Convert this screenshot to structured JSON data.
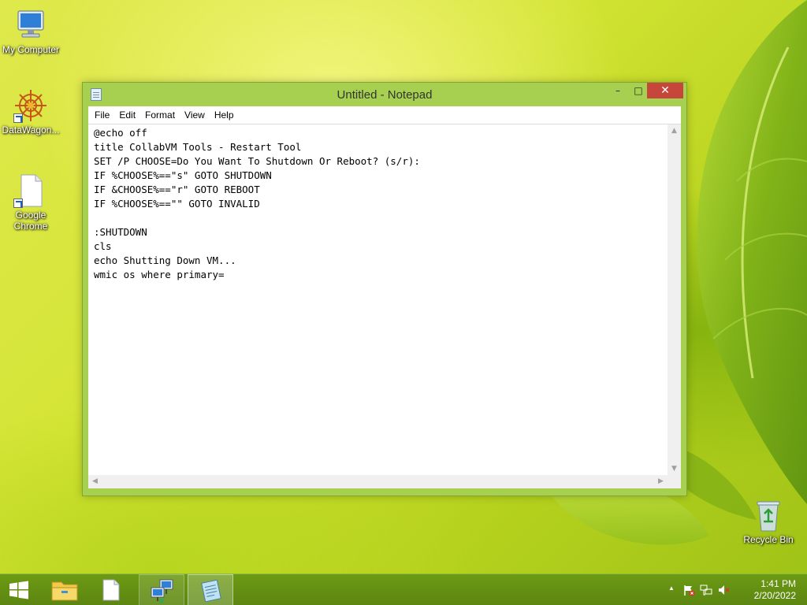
{
  "desktop": {
    "icons": [
      {
        "label": "My Computer",
        "icon": "computer-icon"
      },
      {
        "label": "DataWagon...",
        "icon": "datawagon-icon"
      },
      {
        "label": "Google Chrome",
        "icon": "blank-file-icon"
      },
      {
        "label": "Recycle Bin",
        "icon": "recycle-bin-icon"
      }
    ]
  },
  "window": {
    "title": "Untitled - Notepad",
    "controls": {
      "minimize": "–",
      "maximize": "□",
      "close": "✕"
    },
    "menu": [
      "File",
      "Edit",
      "Format",
      "View",
      "Help"
    ],
    "content": "@echo off\ntitle CollabVM Tools - Restart Tool\nSET /P CHOOSE=Do You Want To Shutdown Or Reboot? (s/r):\nIF %CHOOSE%==\"s\" GOTO SHUTDOWN\nIF &CHOOSE%==\"r\" GOTO REBOOT\nIF %CHOOSE%==\"\" GOTO INVALID\n\n:SHUTDOWN\ncls\necho Shutting Down VM...\nwmic os where primary=",
    "scroll_arrows": {
      "up": "▲",
      "down": "▼",
      "left": "◀",
      "right": "▶"
    }
  },
  "taskbar": {
    "apps": [
      {
        "name": "start",
        "icon": "windows-logo-icon"
      },
      {
        "name": "file-explorer",
        "icon": "folder-icon"
      },
      {
        "name": "blank-document",
        "icon": "document-icon"
      },
      {
        "name": "network-tool",
        "icon": "network-computer-icon"
      },
      {
        "name": "notepad",
        "icon": "notepad-icon"
      }
    ],
    "tray": {
      "show_hidden": "▲",
      "time": "1:41 PM",
      "date": "2/20/2022"
    }
  },
  "colors": {
    "window_frame": "#a7d050",
    "close_button": "#c7463b",
    "taskbar": "#5c8611"
  }
}
